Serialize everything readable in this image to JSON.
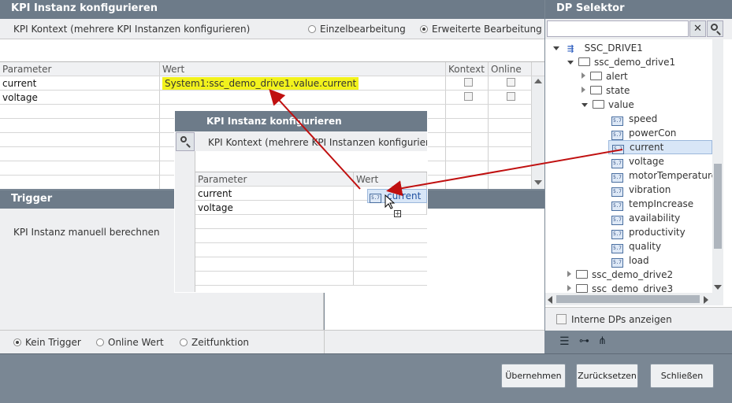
{
  "left_title": "KPI Instanz konfigurieren",
  "context_label": "KPI Kontext (mehrere KPI Instanzen konfigurieren)",
  "mode_single": "Einzelbearbeitung",
  "mode_extended": "Erweiterte Bearbeitung",
  "table": {
    "col_param": "Parameter",
    "col_value": "Wert",
    "col_context": "Kontext",
    "col_online": "Online",
    "rows": [
      {
        "param": "current",
        "value": "System1:ssc_demo_drive1.value.current"
      },
      {
        "param": "voltage",
        "value": ""
      }
    ]
  },
  "trigger": {
    "title": "Trigger",
    "manual": "KPI Instanz manuell berechnen",
    "opt_none": "Kein Trigger",
    "opt_online": "Online Wert",
    "opt_time": "Zeitfunktion"
  },
  "overlay": {
    "title": "KPI Instanz konfigurieren",
    "context_label": "KPI Kontext (mehrere KPI Instanzen konfigurierer",
    "col_param": "Parameter",
    "col_value": "Wert",
    "row1": "current",
    "row2": "voltage",
    "drag_value": "current",
    "dpe_badge": "5.7"
  },
  "dp_selector": {
    "title": "DP Selektor",
    "root": "SSC_DRIVE1",
    "drive1": "ssc_demo_drive1",
    "folders": [
      "alert",
      "state",
      "value"
    ],
    "elements": [
      "speed",
      "powerCon",
      "current",
      "voltage",
      "motorTemperature",
      "vibration",
      "tempIncrease",
      "availability",
      "productivity",
      "quality",
      "load"
    ],
    "drive2": "ssc_demo_drive2",
    "drive3": "ssc_demo_drive3",
    "badge": "5.7",
    "internal_label": "Interne DPs anzeigen"
  },
  "buttons": {
    "apply": "Übernehmen",
    "reset": "Zurücksetzen",
    "close": "Schließen"
  }
}
